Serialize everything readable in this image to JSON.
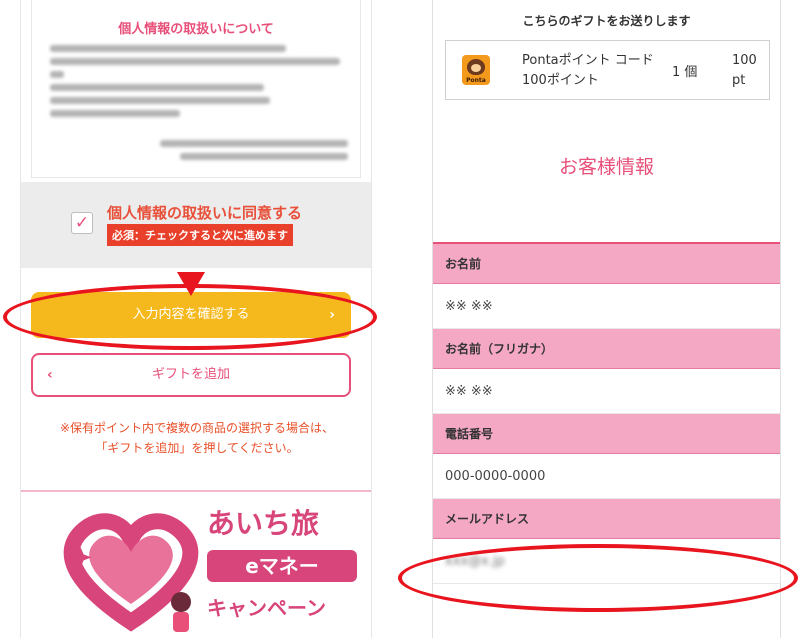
{
  "left_panel": {
    "privacy_title": "個人情報の取扱いについて",
    "consent_label": "個人情報の取扱いに同意する",
    "required_note": "必須：チェックすると次に進めます",
    "checkbox_mark": "✓",
    "confirm_button": "入力内容を確認する",
    "add_gift_button": "ギフトを追加",
    "chevron_right": "›",
    "chevron_left": "‹",
    "note_line1": "※保有ポイント内で複数の商品の選択する場合は、",
    "note_line2": "「ギフトを追加」を押してください。",
    "banner": {
      "title": "あいち旅",
      "emoney": "eマネー",
      "campaign": "キャンペーン"
    }
  },
  "right_panel": {
    "gift_header": "こちらのギフトをお送りします",
    "gift": {
      "icon_text": "Ponta",
      "name": "Pontaポイント コード 100ポイント",
      "quantity": "1 個",
      "price": "100 pt"
    },
    "customer_title": "お客様情報",
    "fields": [
      {
        "label": "お名前",
        "value": "※※ ※※"
      },
      {
        "label": "お名前（フリガナ）",
        "value": "※※ ※※"
      },
      {
        "label": "電話番号",
        "value": "000-0000-0000"
      },
      {
        "label": "メールアドレス",
        "value": "xxx@x.jp"
      }
    ]
  },
  "colors": {
    "pink": "#e8507a",
    "yellow": "#f5b91d",
    "red_annotation": "#e8141e",
    "label_pink": "#f4a8c4"
  }
}
